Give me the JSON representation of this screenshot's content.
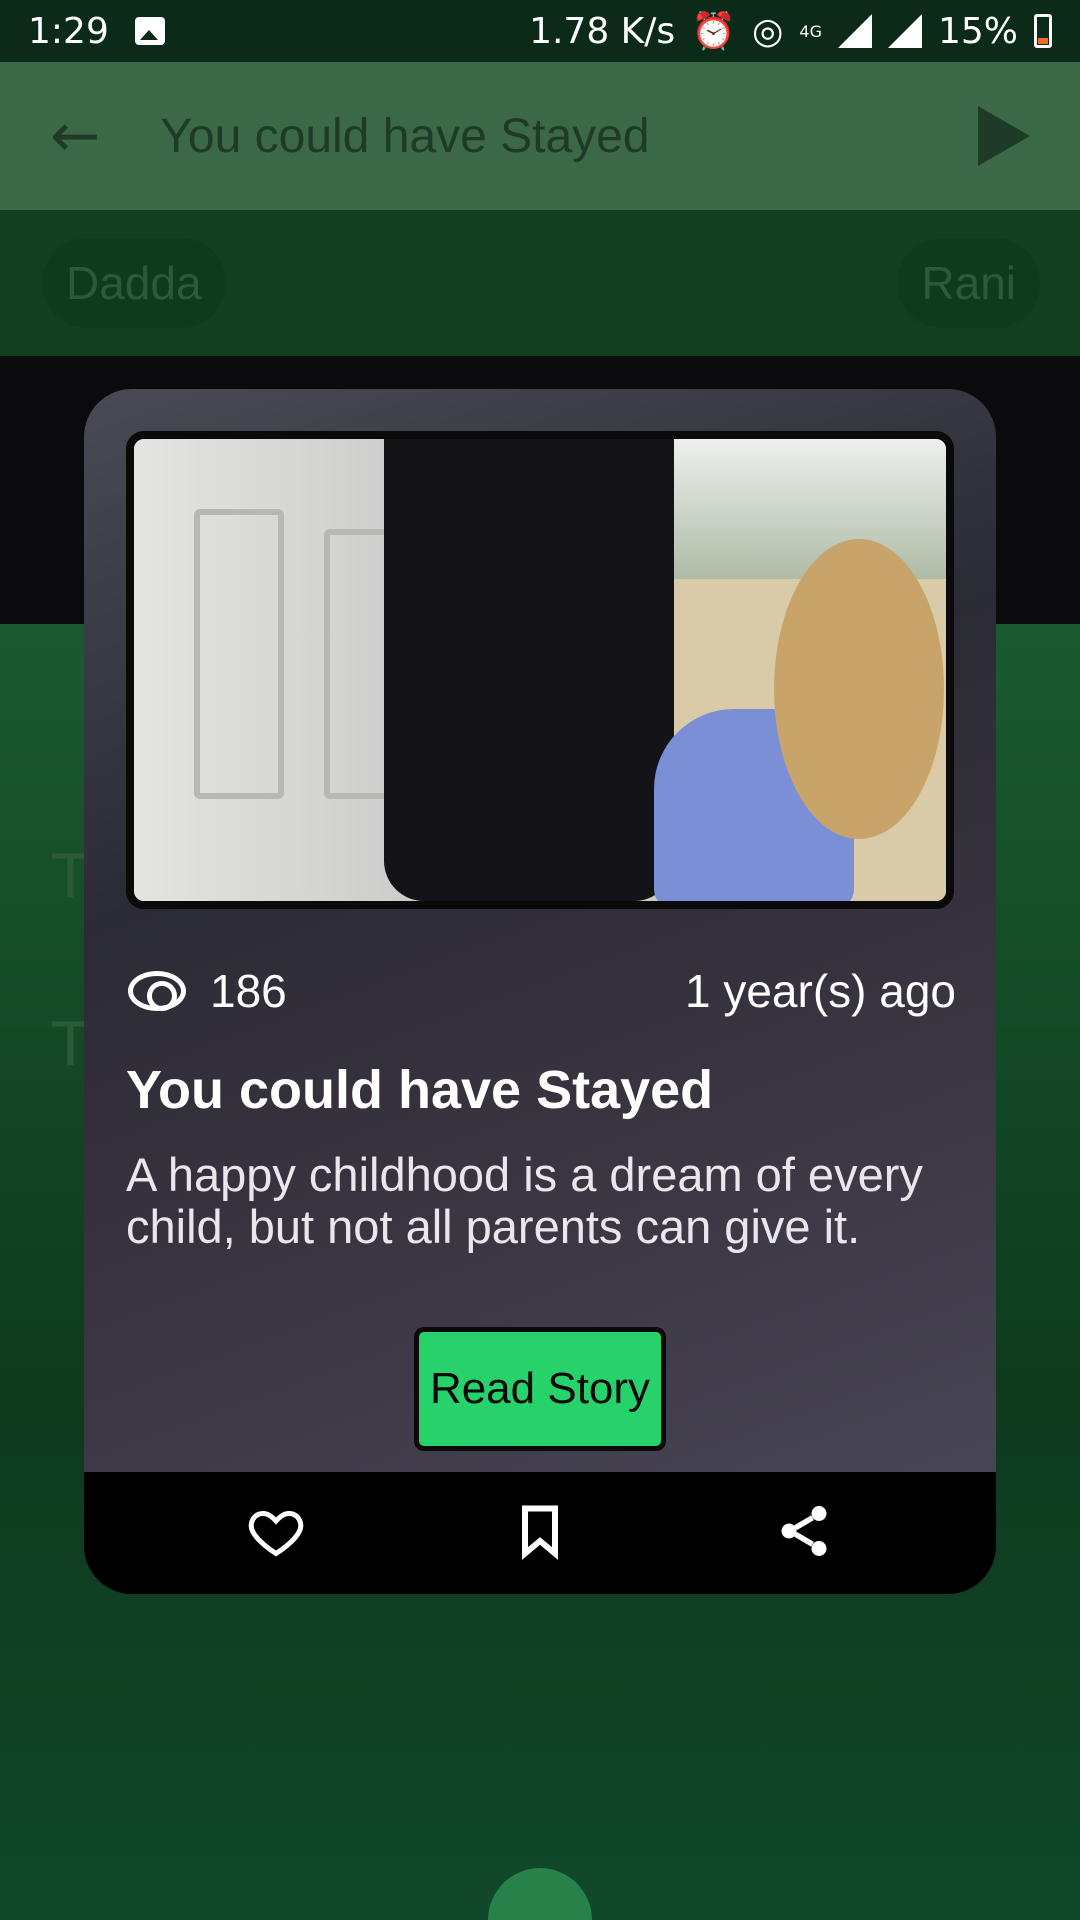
{
  "status_bar": {
    "time": "1:29",
    "net_speed": "1.78 K/s",
    "network": "4G",
    "battery": "15%"
  },
  "app_bar": {
    "back_icon": "arrow-left-icon",
    "title": "You could have Stayed",
    "play_icon": "play-icon"
  },
  "chips": {
    "left": "Dadda",
    "right": "Rani"
  },
  "background_text": [
    "T",
    "T"
  ],
  "card": {
    "views": "186",
    "time_ago": "1 year(s) ago",
    "title": "You could have Stayed",
    "description": "A happy childhood is a dream of every child, but not all parents can give it.",
    "read_button": "Read Story",
    "actions": [
      "heart-icon",
      "bookmark-icon",
      "share-icon"
    ]
  },
  "colors": {
    "accent": "#27d26a",
    "app_bar": "#3b6947",
    "background": "#0f3a21"
  }
}
